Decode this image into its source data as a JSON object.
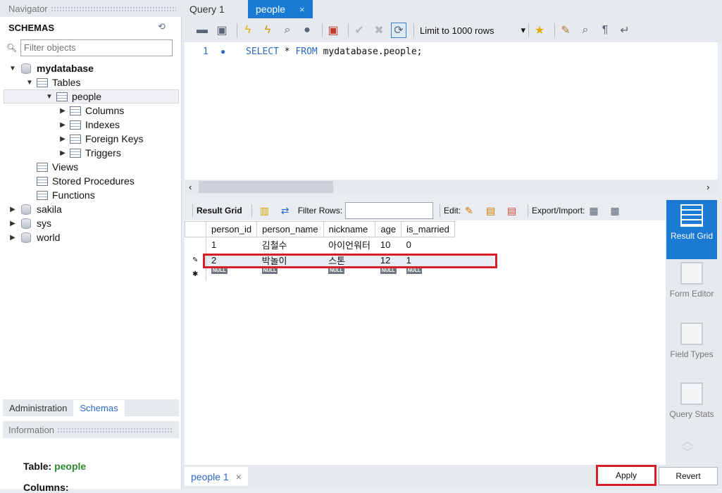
{
  "navigator": {
    "title": "Navigator",
    "schemas_label": "SCHEMAS",
    "filter_placeholder": "Filter objects",
    "tree": {
      "mydatabase": "mydatabase",
      "tables": "Tables",
      "people": "people",
      "columns": "Columns",
      "indexes": "Indexes",
      "foreign_keys": "Foreign Keys",
      "triggers": "Triggers",
      "views": "Views",
      "stored_procedures": "Stored Procedures",
      "functions": "Functions",
      "sakila": "sakila",
      "sys": "sys",
      "world": "world"
    },
    "tabs": {
      "administration": "Administration",
      "schemas": "Schemas"
    },
    "info_title": "Information",
    "info_table_label": "Table:",
    "info_table_value": "people",
    "info_columns_label": "Columns:"
  },
  "query_tabs": {
    "query1": "Query 1",
    "people": "people",
    "close": "×"
  },
  "toolbar": {
    "limit_label": "Limit to 1000 rows",
    "limit_arrow": "▾"
  },
  "editor": {
    "line_number": "1",
    "sql_keyword1": "SELECT",
    "sql_star": " * ",
    "sql_keyword2": "FROM",
    "sql_rest": " mydatabase.people;"
  },
  "result_toolbar": {
    "result_grid": "Result Grid",
    "filter_rows": "Filter Rows:",
    "edit": "Edit:",
    "export_import": "Export/Import:"
  },
  "grid": {
    "columns": [
      "person_id",
      "person_name",
      "nickname",
      "age",
      "is_married"
    ],
    "rows": [
      [
        "1",
        "김철수",
        "아이언워터",
        "10",
        "0"
      ],
      [
        "2",
        "박놀이",
        "스톤",
        "12",
        "1"
      ]
    ],
    "null_label": "NULL",
    "new_row_marker": "✱",
    "edit_marker": "✎"
  },
  "side_panel": {
    "result_grid": "Result Grid",
    "form_editor": "Form Editor",
    "field_types": "Field Types",
    "query_stats": "Query Stats"
  },
  "bottom": {
    "result_tab": "people 1",
    "close": "×",
    "apply": "Apply",
    "revert": "Revert"
  }
}
